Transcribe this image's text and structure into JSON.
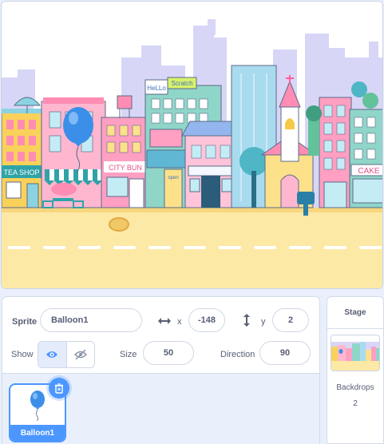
{
  "stage": {
    "backdrop_signs": {
      "tea_shop": "TEA SHOP",
      "hello": "HeLLo",
      "scratch": "Scratch",
      "city_bun": "CITY BUN",
      "cake": "CAKE",
      "open": "open"
    }
  },
  "sprite_info": {
    "sprite_label": "Sprite",
    "sprite_name": "Balloon1",
    "x_label": "x",
    "x_value": "-148",
    "y_label": "y",
    "y_value": "2",
    "show_label": "Show",
    "size_label": "Size",
    "size_value": "50",
    "direction_label": "Direction",
    "direction_value": "90"
  },
  "sprite_list": {
    "sprites": [
      {
        "name": "Balloon1",
        "selected": true
      }
    ]
  },
  "stage_panel": {
    "title": "Stage",
    "backdrops_label": "Backdrops",
    "backdrops_count": "2"
  },
  "colors": {
    "accent": "#4c97ff",
    "text": "#575e75",
    "panel_bg": "#e9f0fb"
  },
  "icons": [
    "x-arrows-icon",
    "y-arrows-icon",
    "eye-icon",
    "eye-hidden-icon",
    "delete-icon",
    "balloon-icon"
  ]
}
